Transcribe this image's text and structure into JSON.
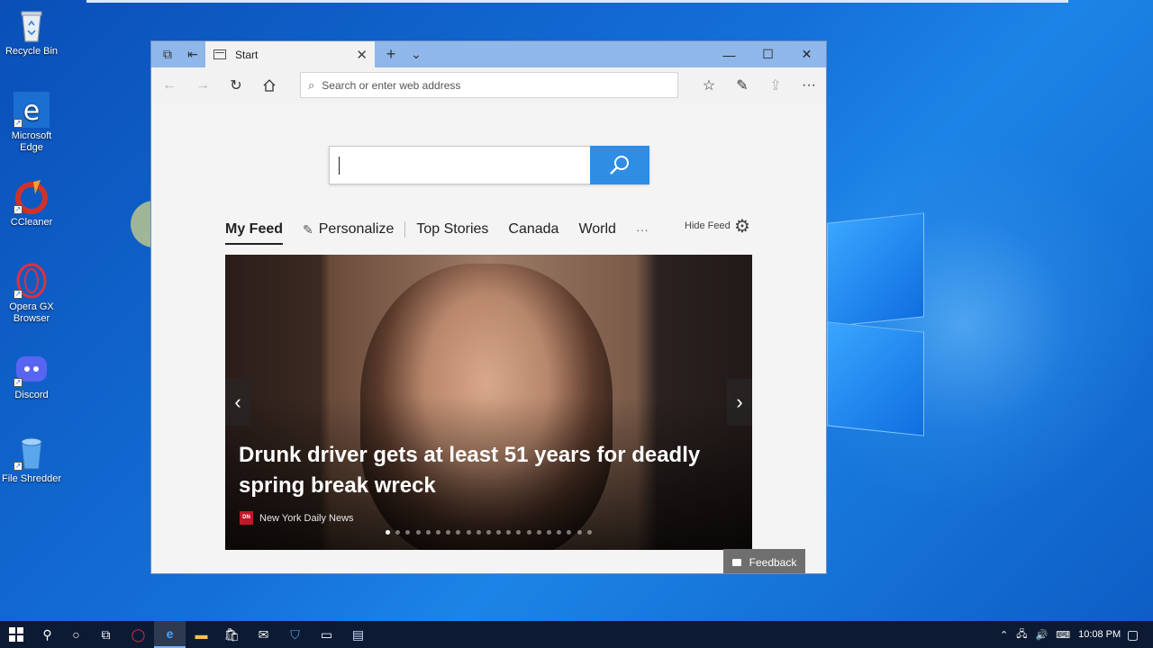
{
  "desktop": {
    "icons": [
      {
        "label": "Recycle Bin",
        "icon": "recycle-bin-icon"
      },
      {
        "label": "Microsoft Edge",
        "icon": "edge-icon"
      },
      {
        "label": "CCleaner",
        "icon": "ccleaner-icon"
      },
      {
        "label": "Opera GX Browser",
        "icon": "opera-gx-icon"
      },
      {
        "label": "Discord",
        "icon": "discord-icon"
      },
      {
        "label": "File Shredder",
        "icon": "file-shredder-icon"
      }
    ]
  },
  "browser": {
    "tab": {
      "title": "Start",
      "close": "✕",
      "new_tab": "+",
      "tab_menu": "⌄"
    },
    "window_controls": {
      "minimize": "—",
      "maximize": "☐",
      "close": "✕"
    },
    "address": {
      "placeholder": "Search or enter web address"
    },
    "toolbar": {
      "more": "···"
    },
    "search": {
      "value": ""
    },
    "feed_nav": {
      "my_feed": "My Feed",
      "personalize": "Personalize",
      "items": [
        "Top Stories",
        "Canada",
        "World"
      ],
      "more": "···",
      "hide_feed": "Hide Feed"
    },
    "hero": {
      "headline": "Drunk driver gets at least 51 years for deadly spring break wreck",
      "source": "New York Daily News",
      "source_logo": "DN",
      "dot_count": 21,
      "active_dot": 1
    },
    "feedback": {
      "label": "Feedback"
    }
  },
  "taskbar": {
    "clock": "10:08 PM"
  },
  "colors": {
    "accent": "#2f8de4",
    "titlebar": "#8fb7ea",
    "taskbar": "#0c1a33"
  }
}
